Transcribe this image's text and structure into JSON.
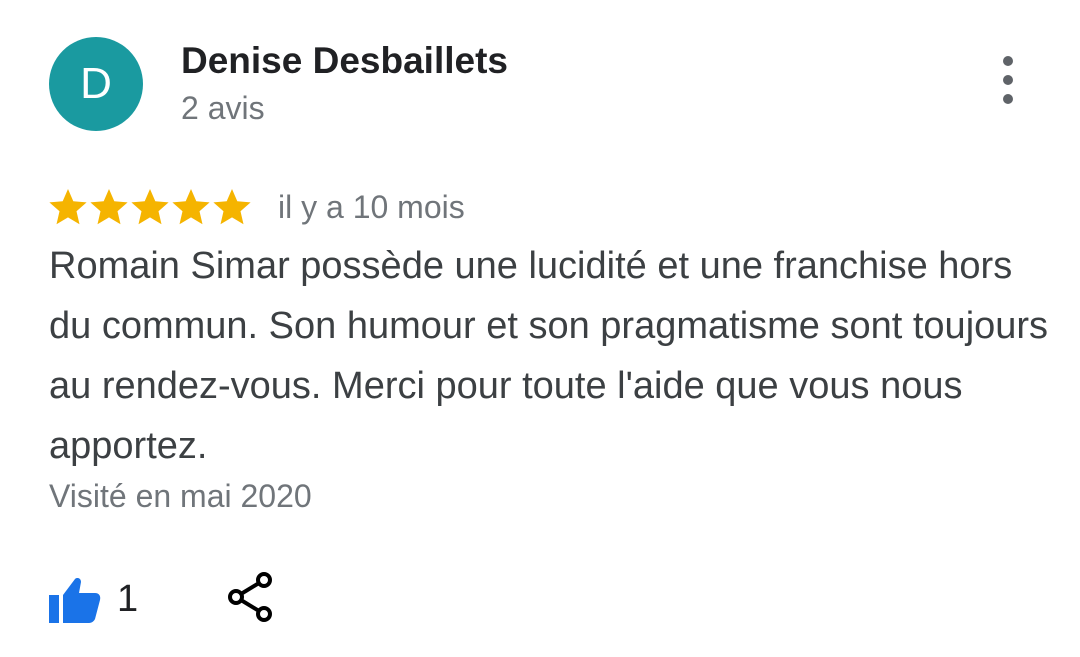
{
  "author": {
    "initial": "D",
    "name": "Denise Desbaillets",
    "review_count": "2 avis",
    "avatar_color": "#1a9aa0"
  },
  "menu": {
    "icon": "more-vert-icon"
  },
  "review": {
    "rating": 5,
    "rating_max": 5,
    "star_color": "#f5b400",
    "time_ago": "il y a 10 mois",
    "text": "Romain Simar possède une lucidité et une franchise hors du commun. Son humour et son pragmatisme sont toujours au rendez-vous. Merci pour toute l'aide que vous nous apportez.",
    "visited": "Visité en mai 2020"
  },
  "actions": {
    "like_icon": "thumbs-up-icon",
    "like_count": "1",
    "like_color": "#1a73e8",
    "share_icon": "share-icon"
  }
}
